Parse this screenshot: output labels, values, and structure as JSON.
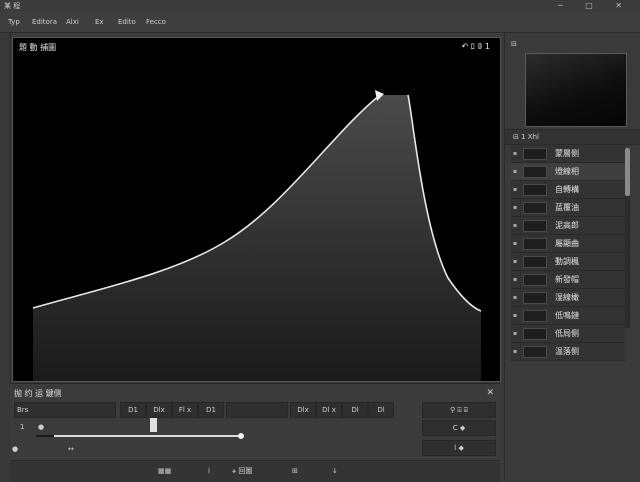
{
  "window": {
    "title": "某 程",
    "controls": "─ □ ✕"
  },
  "menu": [
    "Typ",
    "Editora",
    "Alxi",
    "Ex",
    "Edito",
    "Fecco"
  ],
  "viewport": {
    "title": "題 動 捕圖",
    "top_right": "↶ ﾛ 𝟘 1"
  },
  "curve": {
    "description_values": {
      "start_y": 0.2,
      "peak_y": 0.92,
      "end_y": 0.22
    }
  },
  "bottom": {
    "title": "抛 约 运 鍵侧",
    "close": "✕",
    "row1": {
      "field_label": "Brs",
      "b1": "D1",
      "b2": "Dlx",
      "b3": "Fl x",
      "b4": "D1",
      "b5": "Dlx",
      "b6": "Dl x",
      "b7": "Dl",
      "b8": "Dl",
      "right_tools": "⚲ ⌸ ⌸"
    },
    "row2": {
      "label_a": "1",
      "label_b": "●",
      "right_field": "C ◆"
    },
    "row3": {
      "label_a": "●",
      "arrow": "↔",
      "right_field": "Ì ◆"
    },
    "footer": {
      "b1": "▦▦",
      "b2": "i",
      "b3": "⚹ 回圖",
      "b4": "⊞",
      "b5": "↓"
    }
  },
  "rightpanel": {
    "tab": "⊟",
    "header": "⊟ 1 Xhl",
    "layers": [
      "蒙層侧",
      "燈線相",
      "自轉構",
      "蓝覆油",
      "泥高郎",
      "屬顯曲",
      "動調楓",
      "新發帽",
      "湿線橄",
      "低鳴鏈",
      "低局侧",
      "温落侧"
    ],
    "selected_index": 1
  }
}
